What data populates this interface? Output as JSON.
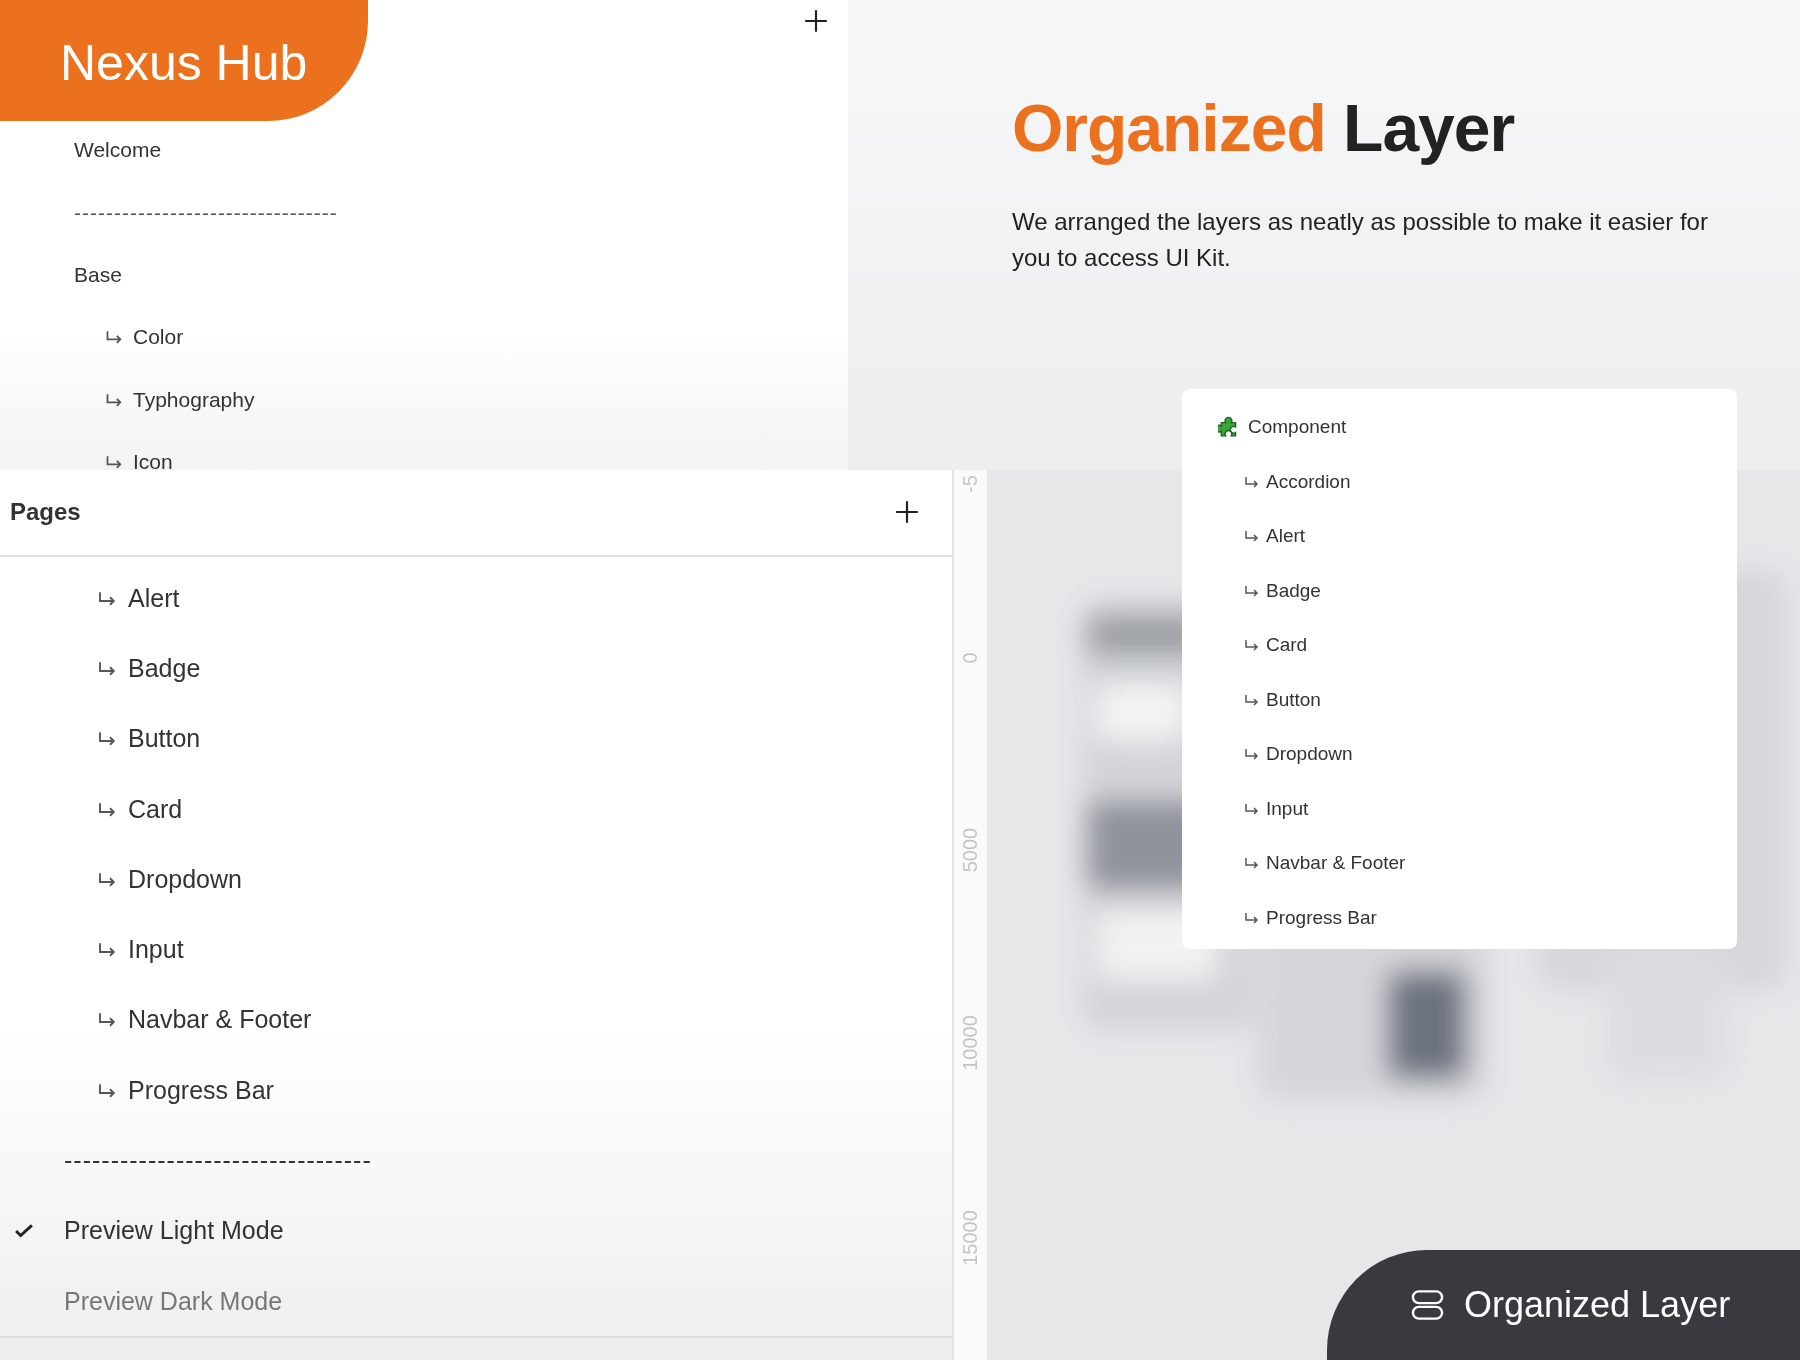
{
  "brand": {
    "name": "Nexus Hub"
  },
  "layers_panel": {
    "items": [
      {
        "kind": "page",
        "label": "Welcome"
      },
      {
        "kind": "divider",
        "label": "---------------------------------"
      },
      {
        "kind": "page",
        "label": "Base"
      },
      {
        "kind": "subpage",
        "label": "Color"
      },
      {
        "kind": "subpage",
        "label": "Typhography"
      },
      {
        "kind": "subpage",
        "label": "Icon"
      }
    ]
  },
  "heading": {
    "highlight": "Organized",
    "rest": "Layer"
  },
  "description": "We arranged the layers as neatly as possible to make it easier for you to access UI Kit.",
  "pages_panel": {
    "title": "Pages",
    "items": [
      {
        "kind": "subpage",
        "label": "Alert"
      },
      {
        "kind": "subpage",
        "label": "Badge"
      },
      {
        "kind": "subpage",
        "label": "Button"
      },
      {
        "kind": "subpage",
        "label": "Card"
      },
      {
        "kind": "subpage",
        "label": "Dropdown"
      },
      {
        "kind": "subpage",
        "label": "Input"
      },
      {
        "kind": "subpage",
        "label": "Navbar & Footer"
      },
      {
        "kind": "subpage",
        "label": "Progress Bar"
      },
      {
        "kind": "divider",
        "label": "---------------------------------"
      },
      {
        "kind": "mode",
        "label": "Preview Light Mode",
        "selected": true
      },
      {
        "kind": "mode",
        "label": "Preview Dark Mode",
        "selected": false
      }
    ]
  },
  "ruler": {
    "ticks": [
      "-5",
      "0",
      "5000",
      "10000",
      "15000"
    ]
  },
  "component_card": {
    "title": "Component",
    "items": [
      "Accordion",
      "Alert",
      "Badge",
      "Card",
      "Button",
      "Dropdown",
      "Input",
      "Navbar & Footer",
      "Progress Bar"
    ]
  },
  "badge": {
    "label": "Organized Layer"
  }
}
